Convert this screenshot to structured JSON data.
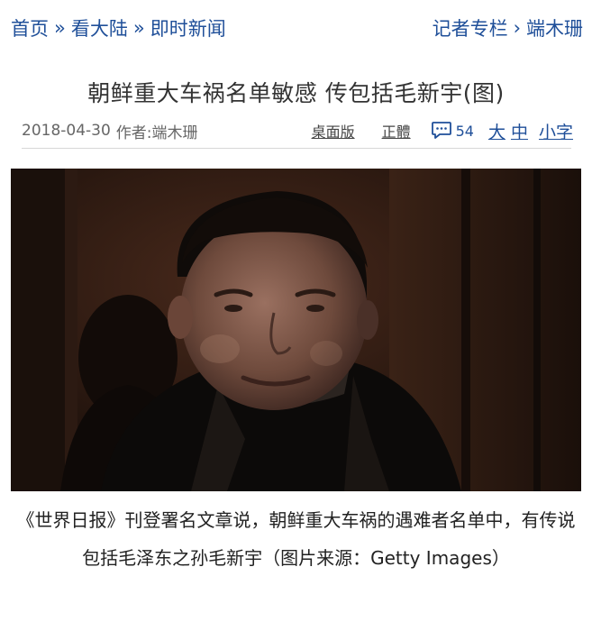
{
  "nav": {
    "breadcrumb": [
      {
        "label": "首页"
      },
      {
        "label": "看大陆"
      },
      {
        "label": "即时新闻"
      }
    ],
    "breadcrumb_sep": "»",
    "column": {
      "label": "记者专栏",
      "sep": "›",
      "author": "端木珊"
    }
  },
  "article": {
    "title": "朝鲜重大车祸名单敏感 传包括毛新宇(图)",
    "date": "2018-04-30",
    "author": "作者:端木珊",
    "desktop_link": "桌面版",
    "traditional_link": "正體",
    "comment_count": "54",
    "font_sizes": {
      "large": "大",
      "medium": "中",
      "small": "小字"
    },
    "image_icon": "photo-of-man-in-dark-coat",
    "caption": "《世界日报》刊登署名文章说，朝鲜重大车祸的遇难者名单中，有传说包括毛泽东之孙毛新宇（图片来源：Getty Images）"
  },
  "colors": {
    "link": "#1f4f99"
  }
}
